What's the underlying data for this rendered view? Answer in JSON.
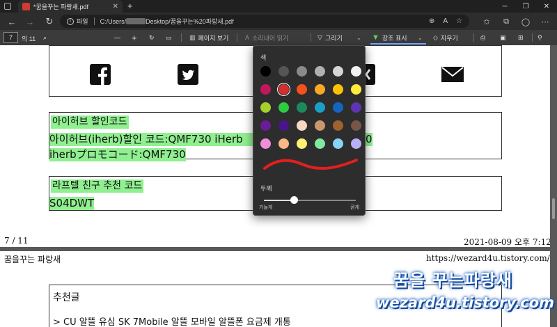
{
  "browser": {
    "tab_title": "*꿈을꾸는 파랑새.pdf",
    "tab_close": "✕",
    "new_tab": "+",
    "address_label": "파일",
    "address_prefix": "C:/Users/",
    "address_suffix": "Desktop/꿈을꾸는%20파랑새.pdf"
  },
  "pdf_toolbar": {
    "page_current": "7",
    "page_total": "의 11",
    "zoom_out": "—",
    "zoom_in": "+",
    "page_view": "페이지 보기",
    "read_aloud": "소리내어 읽기",
    "draw": "그리기",
    "highlight": "강조 표시",
    "erase": "지우기"
  },
  "flyout": {
    "color_label": "색",
    "colors": [
      "#000000",
      "#555555",
      "#8a8a8a",
      "#b0b0b0",
      "#d6d6d6",
      "#f2f2f2",
      "#c2185b",
      "#d32f2f",
      "#f4511e",
      "#f9a825",
      "#ffc107",
      "#ffeb3b",
      "#a4d22b",
      "#2ecc40",
      "#1b8a5a",
      "#1aa0c8",
      "#1565c0",
      "#5e35b1",
      "#6a1b9a",
      "#4a148c",
      "#f8d7c4",
      "#c8986b",
      "#a0622d",
      "#795548",
      "#f08ed8",
      "#f8b889",
      "#fff176",
      "#80e8a0",
      "#88d3f8",
      "#b8b0f8"
    ],
    "selected_index": 7,
    "stroke_color": "#e02020",
    "thickness_label": "두께",
    "thin_label": "가늘게",
    "thick_label": "굵게",
    "thickness_value": 0.33
  },
  "page": {
    "section1_title": "아이허브 할인코드",
    "section1_line1": "아이허브(iherb)할인 코드:QMF730 iHerb",
    "section1_line1_tail": "0",
    "section1_line2": "iherbプロモコード:QMF730",
    "section2_title": "라프텔 친구 추천 코드",
    "section2_code": "S04DWT",
    "footer_page": "7 / 11",
    "footer_date": "2021-08-09 오후 7:12",
    "header_left": "꿈을꾸는 파랑새",
    "header_right": "https://wezard4u.tistory.com/",
    "recommend_title": "추천글",
    "recommend_item1": "> CU 알뜰 유심 SK 7Mobile 알뜰 모바일 알뜰폰 요금제 개통"
  },
  "watermark": {
    "line1": "꿈을 꾸는파랑새",
    "line2": "wezard4u.tistory.com"
  }
}
